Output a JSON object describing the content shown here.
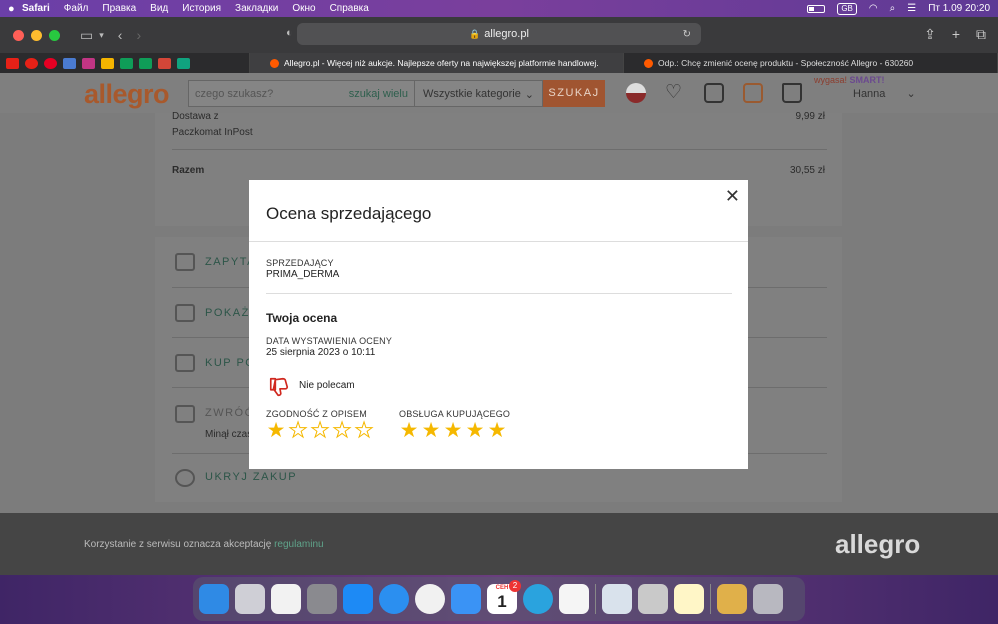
{
  "menubar": {
    "app": "Safari",
    "items": [
      "Файл",
      "Правка",
      "Вид",
      "История",
      "Закладки",
      "Окно",
      "Справка"
    ],
    "input_source": "GB",
    "clock": "Пт 1.09  20:20"
  },
  "browser": {
    "url": "allegro.pl",
    "tabs": [
      {
        "label": "Allegro.pl - Więcej niż aukcje. Najlepsze oferty na największej platformie handlowej."
      },
      {
        "label": "Odp.: Chcę zmienić ocenę produktu - Społeczność Allegro - 630260"
      }
    ]
  },
  "header": {
    "logo": "allegro",
    "search_placeholder": "czego szukasz?",
    "search_hint": "szukaj wielu",
    "category": "Wszystkie kategorie",
    "search_button": "SZUKAJ",
    "promo_prefix": "wygasa!",
    "promo_brand": "SMART!",
    "user": "Hanna"
  },
  "order": {
    "delivery_label": "Dostawa z",
    "delivery_price": "9,99 zł",
    "delivery_method": "Paczkomat InPost",
    "total_label": "Razem",
    "total_value": "30,55 zł",
    "actions": [
      "ZAPYTAJ",
      "POKAŻ W",
      "KUP PON",
      "ZWRÓĆ",
      "UKRYJ ZAKUP"
    ],
    "return_note": "Minął czas"
  },
  "modal": {
    "title": "Ocena sprzedającego",
    "seller_label": "SPRZEDAJĄCY",
    "seller_name": "PRIMA_DERMA",
    "rating_heading": "Twoja ocena",
    "date_label": "DATA WYSTAWIENIA OCENY",
    "date_value": "25 sierpnia 2023 o 10:11",
    "recommend_text": "Nie polecam",
    "ratings": [
      {
        "label": "ZGODNOŚĆ Z OPISEM",
        "value": 1,
        "max": 5
      },
      {
        "label": "OBSŁUGA KUPUJĄCEGO",
        "value": 5,
        "max": 5
      }
    ]
  },
  "footer": {
    "text": "Korzystanie z serwisu oznacza akceptację",
    "link": "regulaminu",
    "logo": "allegro"
  },
  "dock": {
    "calendar_month": "СЕН",
    "calendar_day": "1",
    "badge": "2"
  },
  "colors": {
    "star": "#f5b800",
    "thumb_down": "#d0281f",
    "allegro_orange": "#ff5a00"
  }
}
